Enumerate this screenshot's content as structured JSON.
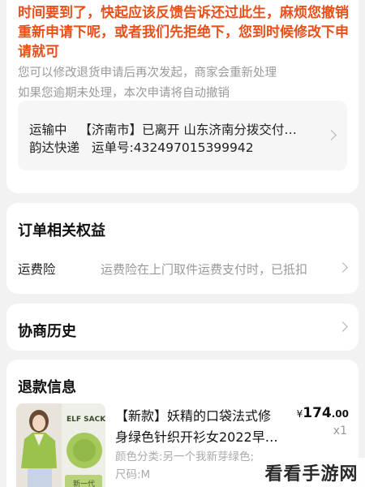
{
  "status_card": {
    "line1": "时间要到了，快起应该反馈告诉还过此生，麻烦您撤销",
    "line2": "重新申请下呢，或者我们先拒绝下，您到时候修改下申",
    "line3": "请就可",
    "hint1": "您可以修改退货申请后再次发起，商家会重新处理",
    "hint2": "如果您逾期未处理，本次申请将自动撤销"
  },
  "logistics": {
    "status": "运输中",
    "detail": "【济南市】已离开 山东济南分拨交付…",
    "carrier": "韵达快递",
    "tracking_label": "运单号:",
    "tracking_number": "432497015399942"
  },
  "benefits": {
    "title": "订单相关权益",
    "label": "运费险",
    "value": "运费险在上门取件运费支付时，已抵扣"
  },
  "history": {
    "title": "协商历史"
  },
  "refund": {
    "title": "退款信息",
    "product_title_1": "【新款】妖精的口袋法式修",
    "product_title_2": "身绿色针织开衫女2022早…",
    "color": "颜色分类:另一个我新芽绿色;",
    "size": "尺码:M",
    "currency": "¥",
    "price_int": "174",
    "price_dec": ".00",
    "qty": "x1",
    "image_text_1": "ELF SACK",
    "image_text_2": "新一代"
  },
  "watermark": "看看手游网",
  "colors": {
    "accent": "#e8501a",
    "muted": "#9a9a9a",
    "swatch": "#8fb548"
  }
}
